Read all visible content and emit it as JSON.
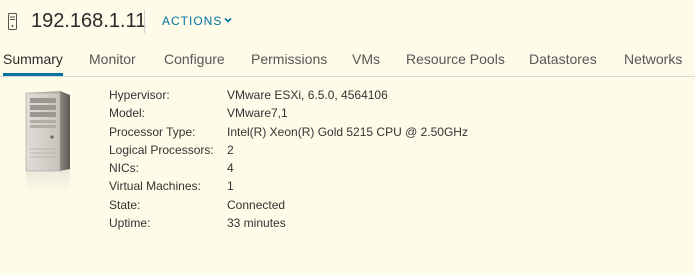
{
  "header": {
    "host_name": "192.168.1.11",
    "actions_label": "ACTIONS",
    "host_icon": "host-server-icon"
  },
  "tabs": [
    {
      "label": "Summary",
      "active": true
    },
    {
      "label": "Monitor",
      "active": false
    },
    {
      "label": "Configure",
      "active": false
    },
    {
      "label": "Permissions",
      "active": false
    },
    {
      "label": "VMs",
      "active": false
    },
    {
      "label": "Resource Pools",
      "active": false
    },
    {
      "label": "Datastores",
      "active": false
    },
    {
      "label": "Networks",
      "active": false
    }
  ],
  "summary": {
    "image": "server-tower-illustration",
    "properties": [
      {
        "label": "Hypervisor:",
        "value": "VMware ESXi, 6.5.0, 4564106"
      },
      {
        "label": "Model:",
        "value": "VMware7,1"
      },
      {
        "label": "Processor Type:",
        "value": "Intel(R) Xeon(R) Gold 5215 CPU @ 2.50GHz"
      },
      {
        "label": "Logical Processors:",
        "value": "2"
      },
      {
        "label": "NICs:",
        "value": "4"
      },
      {
        "label": "Virtual Machines:",
        "value": "1"
      },
      {
        "label": "State:",
        "value": "Connected"
      },
      {
        "label": "Uptime:",
        "value": "33 minutes"
      }
    ]
  },
  "colors": {
    "background": "#fefbe9",
    "accent": "#0072a3",
    "text": "#333333"
  }
}
